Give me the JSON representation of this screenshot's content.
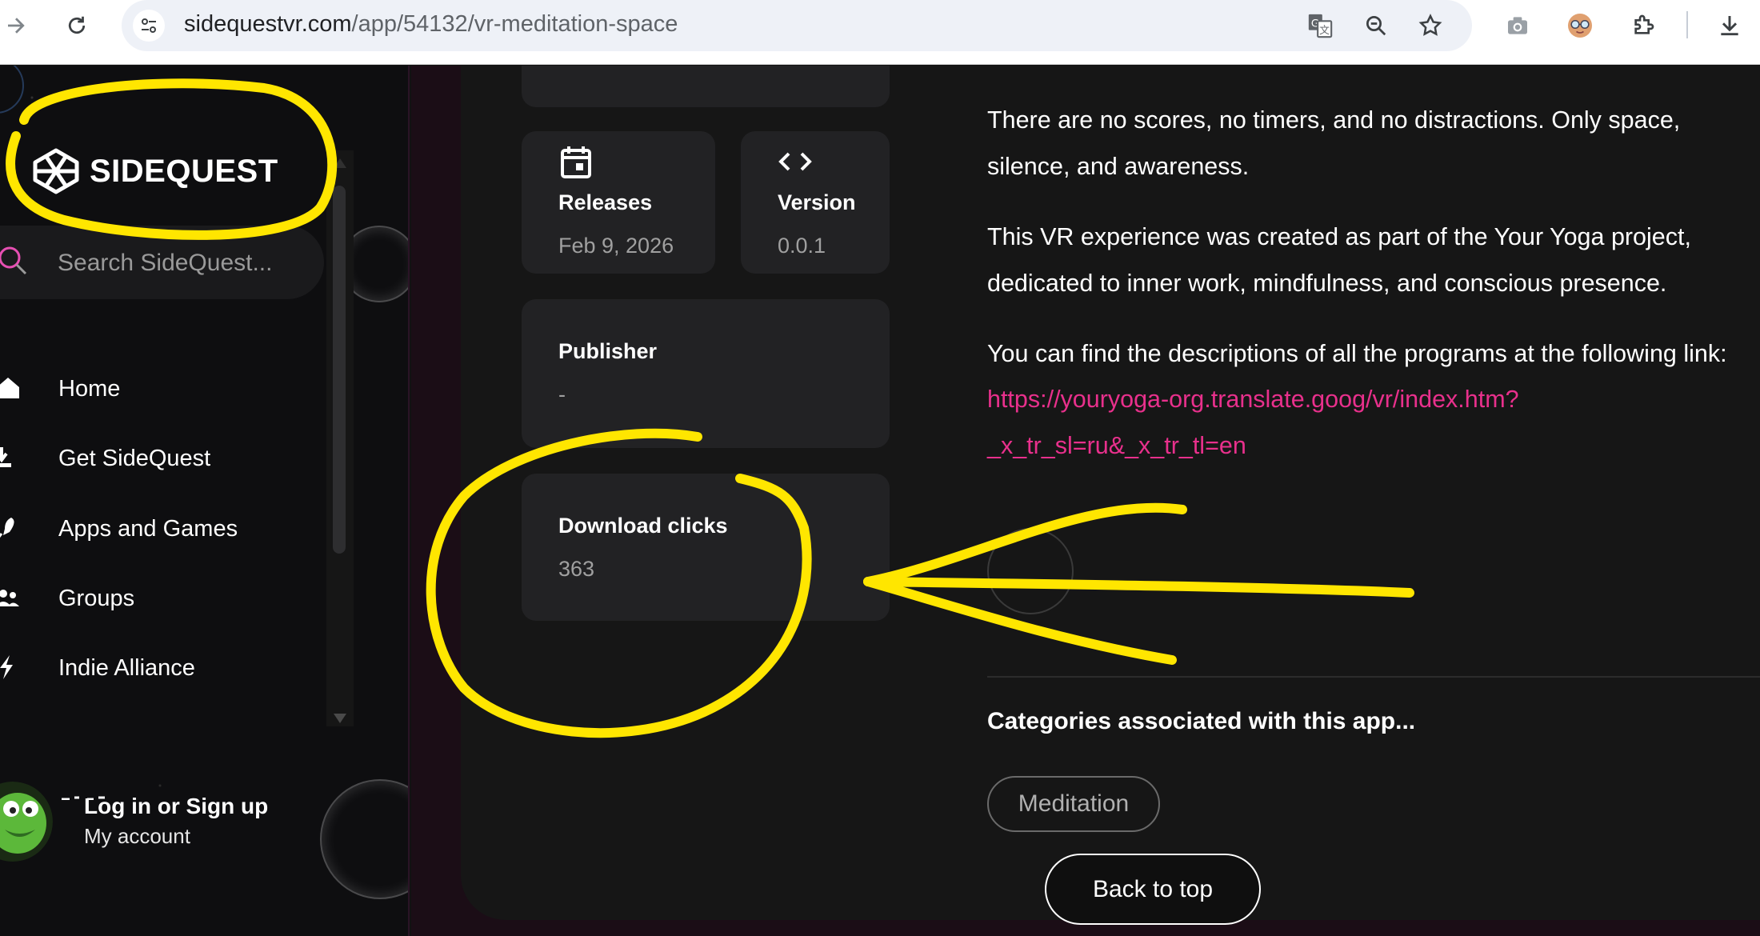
{
  "browser": {
    "url_host": "sidequestvr.com",
    "url_path": "/app/54132/vr-meditation-space"
  },
  "sidebar": {
    "logo_text": "SIDEQUEST",
    "search_placeholder": "Search SideQuest...",
    "items": [
      {
        "label": "Home",
        "icon": "home-icon"
      },
      {
        "label": "Get SideQuest",
        "icon": "download-icon"
      },
      {
        "label": "Apps and Games",
        "icon": "rocket-icon"
      },
      {
        "label": "Groups",
        "icon": "group-icon"
      },
      {
        "label": "Indie Alliance",
        "icon": "bolt-icon"
      }
    ],
    "account": {
      "title": "Log in or Sign up",
      "subtitle": "My account"
    }
  },
  "details": {
    "releases_label": "Releases",
    "releases_value": "Feb 9, 2026",
    "version_label": "Version",
    "version_value": "0.0.1",
    "publisher_label": "Publisher",
    "publisher_value": "-",
    "downloads_label": "Download clicks",
    "downloads_value": "363"
  },
  "description": {
    "line1": "There are no scores, no timers, and no distractions. Only space,",
    "line2": "silence, and awareness.",
    "line3": "This VR experience was created as part of the Your Yoga project,",
    "line4": "dedicated to inner work, mindfulness, and conscious presence.",
    "line5": "You can find the descriptions of all the programs at the following link:",
    "link_line1": "https://youryoga-org.translate.goog/vr/index.htm?",
    "link_line2": "_x_tr_sl=ru&_x_tr_tl=en"
  },
  "categories": {
    "title": "Categories associated with this app...",
    "chip": "Meditation"
  },
  "back_to_top": "Back to top",
  "colors": {
    "link": "#e8308c",
    "annotation": "#ffe600",
    "background": "#161616"
  }
}
